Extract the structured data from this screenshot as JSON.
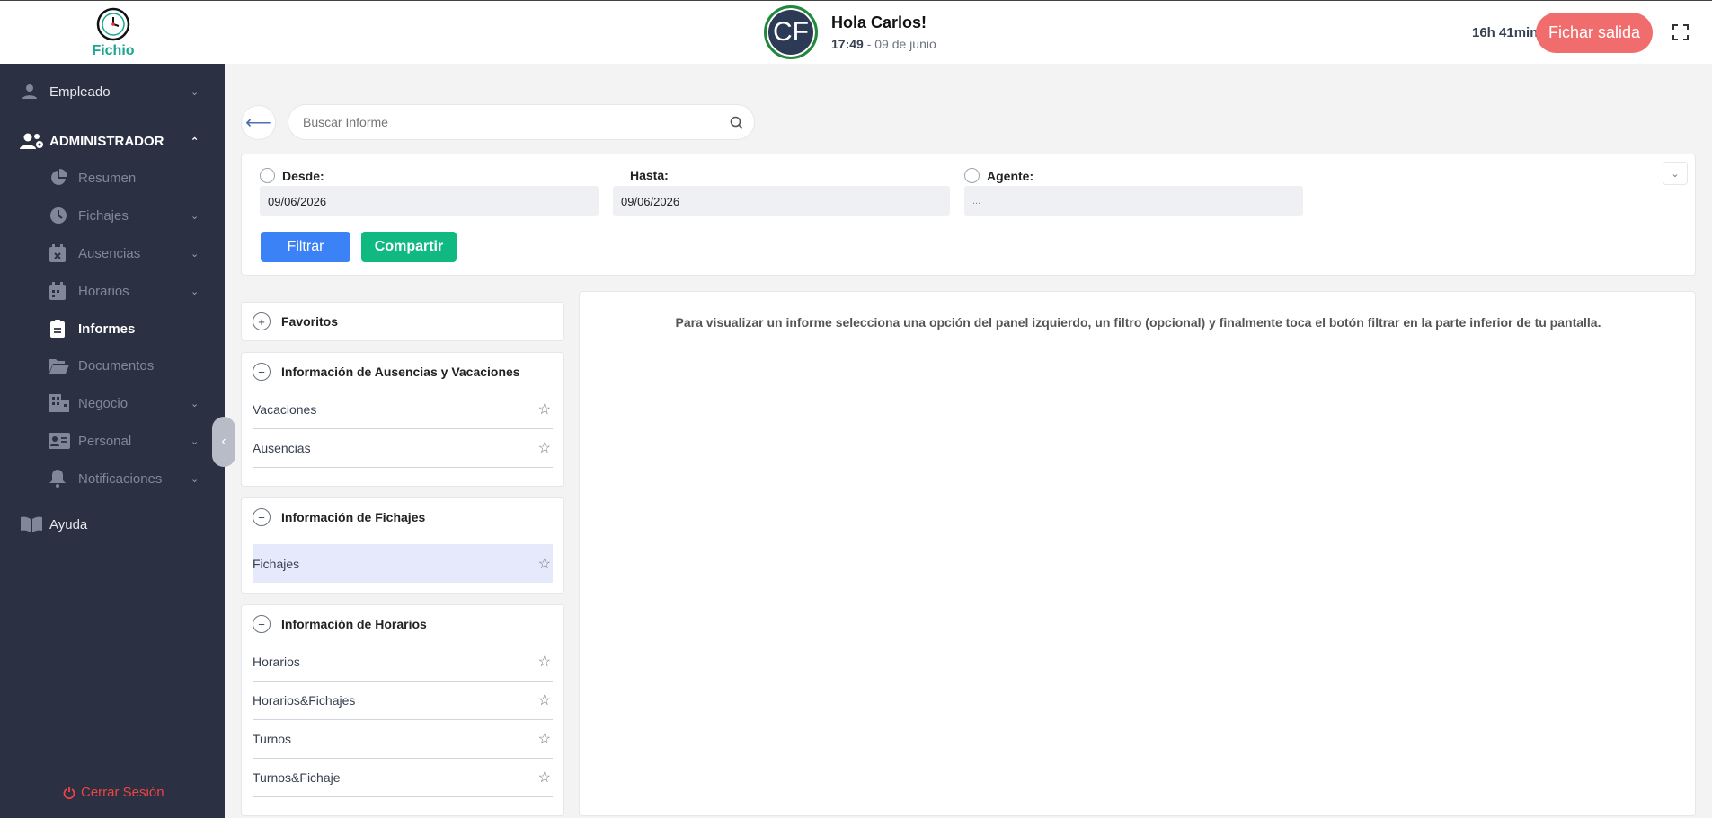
{
  "header": {
    "logo_text": "Fichio",
    "avatar_initials": "CF",
    "greeting": "Hola Carlos!",
    "time": "17:49",
    "date": "- 09 de junio",
    "timer": "16h 41min",
    "fichar_label": "Fichar salida"
  },
  "sidebar": {
    "empleado": "Empleado",
    "administrador": "ADMINISTRADOR",
    "items": {
      "resumen": "Resumen",
      "fichajes": "Fichajes",
      "ausencias": "Ausencias",
      "horarios": "Horarios",
      "informes": "Informes",
      "documentos": "Documentos",
      "negocio": "Negocio",
      "personal": "Personal",
      "notificaciones": "Notificaciones"
    },
    "ayuda": "Ayuda",
    "logout": "Cerrar Sesión"
  },
  "search": {
    "placeholder": "Buscar Informe"
  },
  "filters": {
    "desde_label": "Desde:",
    "desde_value": "09/06/2026",
    "hasta_label": "Hasta:",
    "hasta_value": "09/06/2026",
    "agente_label": "Agente:",
    "agente_value": "...",
    "filtrar": "Filtrar",
    "compartir": "Compartir"
  },
  "panels": {
    "favoritos": "Favoritos",
    "ausencias": {
      "title": "Información de Ausencias y Vacaciones",
      "items": [
        "Vacaciones",
        "Ausencias"
      ]
    },
    "fichajes": {
      "title": "Información de Fichajes",
      "items": [
        "Fichajes"
      ]
    },
    "horarios": {
      "title": "Información de Horarios",
      "items": [
        "Horarios",
        "Horarios&Fichajes",
        "Turnos",
        "Turnos&Fichaje"
      ]
    }
  },
  "content": {
    "message": "Para visualizar un informe selecciona una opción del panel izquierdo, un filtro (opcional) y finalmente toca el botón filtrar en la parte inferior de tu pantalla."
  }
}
